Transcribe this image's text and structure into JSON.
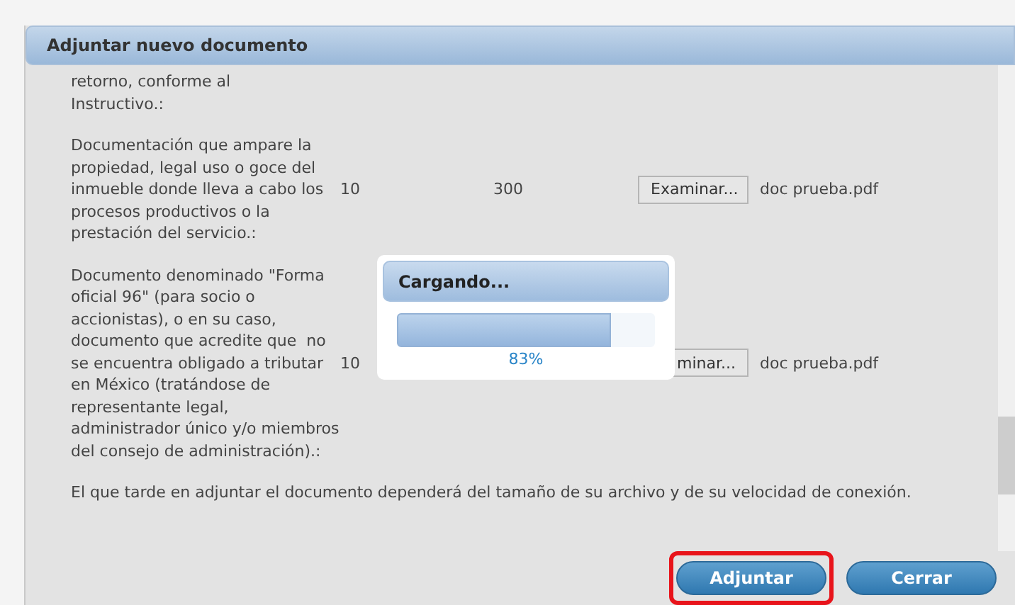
{
  "dialog": {
    "title": "Adjuntar nuevo documento"
  },
  "documents": [
    {
      "description": "retorno, conforme al\nInstructivo.:"
    },
    {
      "description": "Documentación que ampare la propiedad, legal uso o goce del inmueble donde lleva a cabo los procesos productivos o la prestación del servicio.:",
      "column_2": "10",
      "column_3": "300",
      "browse_label": "Examinar...",
      "file": "doc prueba.pdf"
    },
    {
      "description": "Documento denominado \"Forma oficial 96\" (para socio o accionistas), o en su caso, documento que acredite que  no se encuentra obligado a tributar en México (tratándose de representante legal, administrador único y/o miembros del consejo de administración).:",
      "column_2": "10",
      "browse_label": "minar...",
      "file": "doc prueba.pdf"
    }
  ],
  "note": "El que tarde en adjuntar el documento dependerá del tamaño de su archivo y de su velocidad de conexión.",
  "loading": {
    "title": "Cargando...",
    "level": 0.83,
    "reading": "83%"
  },
  "buttons": [
    {
      "label": "Adjuntar",
      "highlighted": true
    },
    {
      "label": "Cerrar",
      "highlighted": false
    }
  ]
}
